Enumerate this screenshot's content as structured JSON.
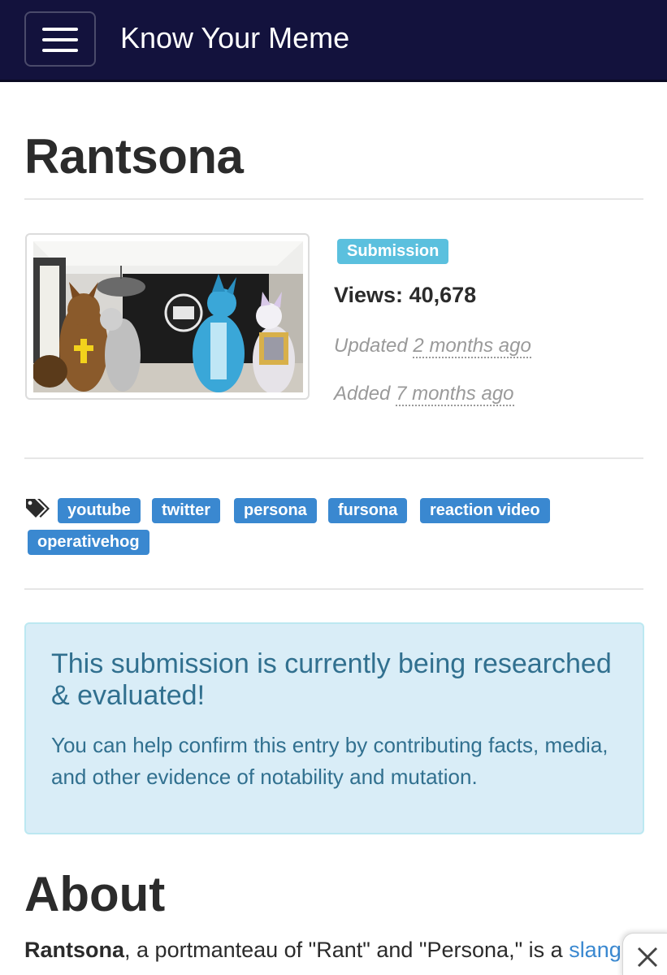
{
  "header": {
    "menu_icon": "hamburger-menu-icon",
    "site_title": "Know Your Meme"
  },
  "entry": {
    "title": "Rantsona",
    "status_badge": "Submission",
    "views_label": "Views:",
    "views_value": "40,678",
    "updated_label": "Updated",
    "updated_value": "2 months ago",
    "added_label": "Added",
    "added_value": "7 months ago"
  },
  "tags": {
    "icon": "tags-icon",
    "items": [
      "youtube",
      "twitter",
      "persona",
      "fursona",
      "reaction video",
      "operativehog"
    ]
  },
  "alert": {
    "heading": "This submission is currently being researched & evaluated!",
    "text": "You can help confirm this entry by contributing facts, media, and other evidence of notability and mutation."
  },
  "about": {
    "heading": "About",
    "term": "Rantsona",
    "text_part1": ", a portmanteau of \"Rant\" and \"Persona,\" is a ",
    "link_text": "slang"
  },
  "overlay": {
    "close_icon": "close-icon"
  },
  "colors": {
    "header_bg": "#13123d",
    "badge_info": "#5bc0de",
    "tag_bg": "#3a88d0",
    "alert_bg": "#d9edf7",
    "alert_text": "#31708f"
  }
}
